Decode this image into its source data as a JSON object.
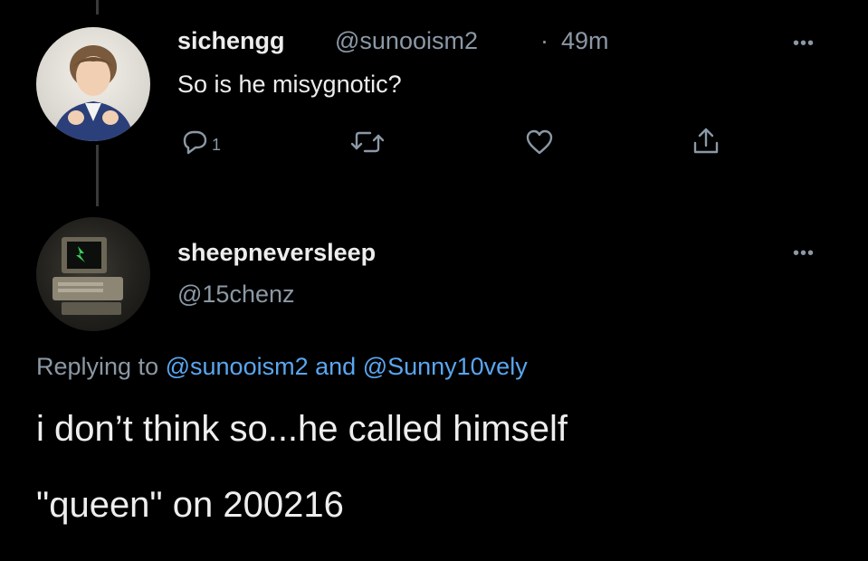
{
  "tweet1": {
    "display_name": "sichengg",
    "handle": "@sunooism2",
    "separator": "·",
    "time": "49m",
    "text": "So is he misygnotic?",
    "reply_count": "1",
    "more_label": "•••"
  },
  "tweet2": {
    "display_name": "sheepneversleep",
    "handle": "@15chenz",
    "more_label": "•••",
    "replying_prefix": "Replying to",
    "replying_mention1": "@sunooism2",
    "replying_and": "and",
    "replying_mention2": "@Sunny10vely",
    "text_line1": "i don’t think so...he called himself",
    "text_line2": "\"queen\" on 200216"
  },
  "colors": {
    "background": "#000000",
    "text_primary": "#ededed",
    "text_secondary": "#8b98a5",
    "mention": "#5aa6f0"
  },
  "icons": {
    "reply": "reply-icon",
    "retweet": "retweet-icon",
    "like": "heart-icon",
    "share": "share-icon",
    "more": "more-icon"
  }
}
